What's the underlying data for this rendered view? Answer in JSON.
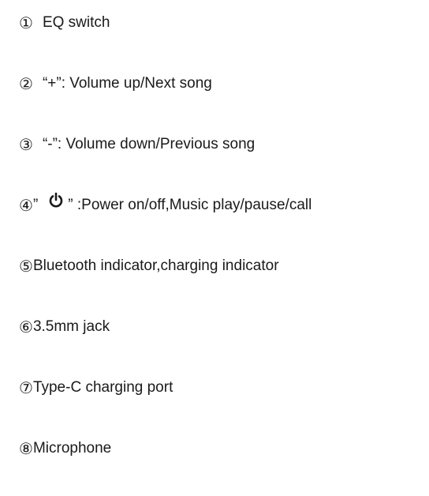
{
  "items": [
    {
      "marker": "①",
      "text": "EQ switch"
    },
    {
      "marker": "②",
      "text": "“+”: Volume up/Next song"
    },
    {
      "marker": "③",
      "text": "“-”: Volume down/Previous song"
    },
    {
      "marker": "④",
      "prefix": "”",
      "icon": "power-icon",
      "text": "” :Power on/off,Music play/pause/call"
    },
    {
      "marker": "⑤",
      "text": "Bluetooth indicator,charging indicator"
    },
    {
      "marker": "⑥",
      "text": "3.5mm jack"
    },
    {
      "marker": "⑦",
      "text": "Type-C charging port"
    },
    {
      "marker": "⑧",
      "text": "Microphone"
    }
  ]
}
